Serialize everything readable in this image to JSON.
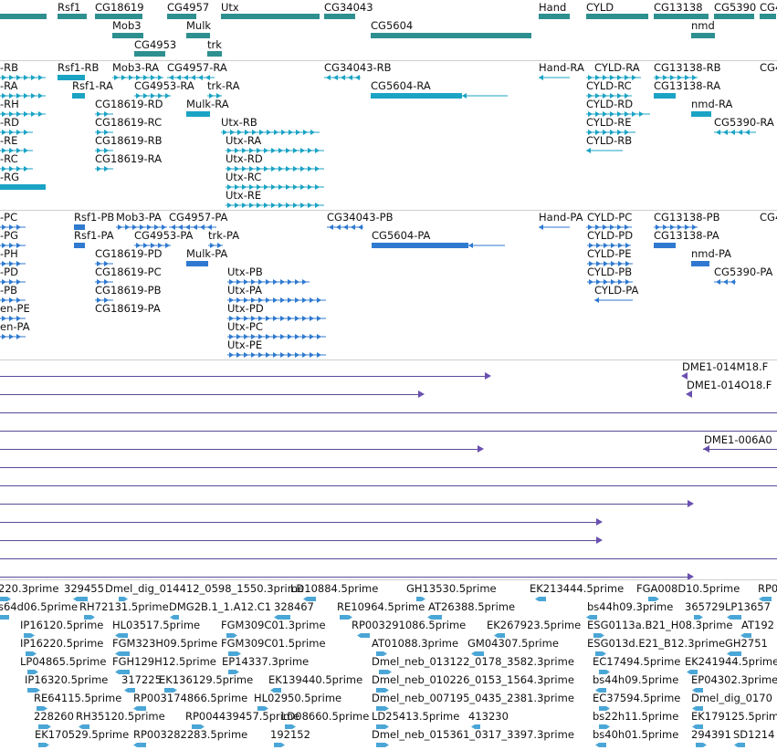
{
  "colors": {
    "gene": "#2e8f8f",
    "transcript": "#1aa3c4",
    "protein": "#2f7ad0",
    "read": "#5a4a9a",
    "read_head": "#6a50b0",
    "est": "#4aa6d6",
    "separator": "#cfcfcf"
  },
  "genes": [
    {
      "label": "Rsf1",
      "strand": "+"
    },
    {
      "label": "CG18619",
      "strand": "+"
    },
    {
      "label": "CG4957",
      "strand": "-"
    },
    {
      "label": "Utx",
      "strand": "+"
    },
    {
      "label": "CG34043",
      "strand": "-"
    },
    {
      "label": "Hand",
      "strand": "+"
    },
    {
      "label": "CYLD",
      "strand": "+"
    },
    {
      "label": "CG13138",
      "strand": "+"
    },
    {
      "label": "CG5390",
      "strand": "-"
    },
    {
      "label": "CG4",
      "strand": "-"
    },
    {
      "label": "Mob3",
      "strand": "+"
    },
    {
      "label": "Mulk",
      "strand": "+"
    },
    {
      "label": "CG5604",
      "strand": "+"
    },
    {
      "label": "nmd",
      "strand": "+"
    },
    {
      "label": "CG4953",
      "strand": "+"
    },
    {
      "label": "trk",
      "strand": "+"
    }
  ],
  "transcripts": [
    {
      "label": "-RB"
    },
    {
      "label": "Rsf1-RB"
    },
    {
      "label": "Mob3-RA"
    },
    {
      "label": "CG4957-RA"
    },
    {
      "label": "CG34043-RB"
    },
    {
      "label": "Hand-RA"
    },
    {
      "label": "CYLD-RA"
    },
    {
      "label": "CG13138-RB"
    },
    {
      "label": "CG4"
    },
    {
      "label": "-RA"
    },
    {
      "label": "Rsf1-RA"
    },
    {
      "label": "CG4953-RA"
    },
    {
      "label": "trk-RA"
    },
    {
      "label": "CG5604-RA"
    },
    {
      "label": "CYLD-RC"
    },
    {
      "label": "CG13138-RA"
    },
    {
      "label": "-RH"
    },
    {
      "label": "CG18619-RD"
    },
    {
      "label": "Mulk-RA"
    },
    {
      "label": "CYLD-RD"
    },
    {
      "label": "nmd-RA"
    },
    {
      "label": "-RD"
    },
    {
      "label": "CG18619-RC"
    },
    {
      "label": "Utx-RB"
    },
    {
      "label": "CYLD-RE"
    },
    {
      "label": "CG5390-RA"
    },
    {
      "label": "-RE"
    },
    {
      "label": "CG18619-RB"
    },
    {
      "label": "Utx-RA"
    },
    {
      "label": "CYLD-RB"
    },
    {
      "label": "-RC"
    },
    {
      "label": "CG18619-RA"
    },
    {
      "label": "Utx-RD"
    },
    {
      "label": "-RG"
    },
    {
      "label": "Utx-RC"
    },
    {
      "label": "Utx-RE"
    }
  ],
  "proteins": [
    {
      "label": "-PC"
    },
    {
      "label": "Rsf1-PB"
    },
    {
      "label": "Mob3-PA"
    },
    {
      "label": "CG4957-PA"
    },
    {
      "label": "CG34043-PB"
    },
    {
      "label": "Hand-PA"
    },
    {
      "label": "CYLD-PC"
    },
    {
      "label": "CG13138-PB"
    },
    {
      "label": "CG4"
    },
    {
      "label": "-PG"
    },
    {
      "label": "Rsf1-PA"
    },
    {
      "label": "CG4953-PA"
    },
    {
      "label": "trk-PA"
    },
    {
      "label": "CG5604-PA"
    },
    {
      "label": "CYLD-PD"
    },
    {
      "label": "CG13138-PA"
    },
    {
      "label": "-PH"
    },
    {
      "label": "CG18619-PD"
    },
    {
      "label": "Mulk-PA"
    },
    {
      "label": "CYLD-PE"
    },
    {
      "label": "nmd-PA"
    },
    {
      "label": "-PD"
    },
    {
      "label": "CG18619-PC"
    },
    {
      "label": "Utx-PB"
    },
    {
      "label": "CYLD-PB"
    },
    {
      "label": "CG5390-PA"
    },
    {
      "label": "-PB"
    },
    {
      "label": "CG18619-PB"
    },
    {
      "label": "Utx-PA"
    },
    {
      "label": "CYLD-PA"
    },
    {
      "label": "en-PE"
    },
    {
      "label": "CG18619-PA"
    },
    {
      "label": "Utx-PD"
    },
    {
      "label": "en-PA"
    },
    {
      "label": "Utx-PC"
    },
    {
      "label": "Utx-PE"
    }
  ],
  "reads": [
    {
      "label": "DME1-014M18.F"
    },
    {
      "label": "DME1-014O18.F"
    },
    {
      "label": "DME1-006A0"
    }
  ],
  "ests": [
    {
      "label": "220.3prime"
    },
    {
      "label": "329455"
    },
    {
      "label": "Dmel_dig_014412_0598_1550.3prime"
    },
    {
      "label": "LD10884.5prime"
    },
    {
      "label": "GH13530.5prime"
    },
    {
      "label": "EK213444.5prime"
    },
    {
      "label": "FGA008D10.5prime"
    },
    {
      "label": "RP0"
    },
    {
      "label": "s64d06.5prime"
    },
    {
      "label": "RH72131.5prime"
    },
    {
      "label": "DMG2B.1_1.A12.C1"
    },
    {
      "label": "328467"
    },
    {
      "label": "RE10964.5prime"
    },
    {
      "label": "AT26388.5prime"
    },
    {
      "label": "bs44h09.3prime"
    },
    {
      "label": "365729"
    },
    {
      "label": "LP13657"
    },
    {
      "label": "IP16120.5prime"
    },
    {
      "label": "HL03517.5prime"
    },
    {
      "label": "FGM309C01.3prime"
    },
    {
      "label": "RP003291086.5prime"
    },
    {
      "label": "EK267923.5prime"
    },
    {
      "label": "ESG0113a.B21_H08.3prime"
    },
    {
      "label": "AT192"
    },
    {
      "label": "IP16220.5prime"
    },
    {
      "label": "FGM323H09.5prime"
    },
    {
      "label": "FGM309C01.5prime"
    },
    {
      "label": "AT01088.3prime"
    },
    {
      "label": "GM04307.5prime"
    },
    {
      "label": "ESG013d.E21_B12.3prime"
    },
    {
      "label": "GH2751"
    },
    {
      "label": "LP04865.5prime"
    },
    {
      "label": "FGH129H12.5prime"
    },
    {
      "label": "EP14337.3prime"
    },
    {
      "label": "Dmel_neb_013122_0178_3582.3prime"
    },
    {
      "label": "EC17494.5prime"
    },
    {
      "label": "EK241944.5prime"
    },
    {
      "label": "IP16320.5prime"
    },
    {
      "label": "317225"
    },
    {
      "label": "EK136129.5prime"
    },
    {
      "label": "EK139440.5prime"
    },
    {
      "label": "Dmel_neb_010226_0153_1564.3prime"
    },
    {
      "label": "bs44h09.5prime"
    },
    {
      "label": "EP04302.3prime"
    },
    {
      "label": "RE64115.5prime"
    },
    {
      "label": "RP003174866.5prime"
    },
    {
      "label": "HL02950.5prime"
    },
    {
      "label": "Dmel_neb_007195_0435_2381.3prime"
    },
    {
      "label": "EC37594.5prime"
    },
    {
      "label": "Dmel_dig_0170"
    },
    {
      "label": "228260"
    },
    {
      "label": "RH35120.5prime"
    },
    {
      "label": "RP004439457.5prime"
    },
    {
      "label": "LD08660.5prime"
    },
    {
      "label": "LD25413.5prime"
    },
    {
      "label": "413230"
    },
    {
      "label": "bs22h11.5prime"
    },
    {
      "label": "EK179125.5prime"
    },
    {
      "label": "EK170529.5prime"
    },
    {
      "label": "RP003282283.5prime"
    },
    {
      "label": "192152"
    },
    {
      "label": "Dmel_neb_015361_0317_3397.3prime"
    },
    {
      "label": "bs40h01.5prime"
    },
    {
      "label": "294391"
    },
    {
      "label": "SD1214"
    }
  ]
}
